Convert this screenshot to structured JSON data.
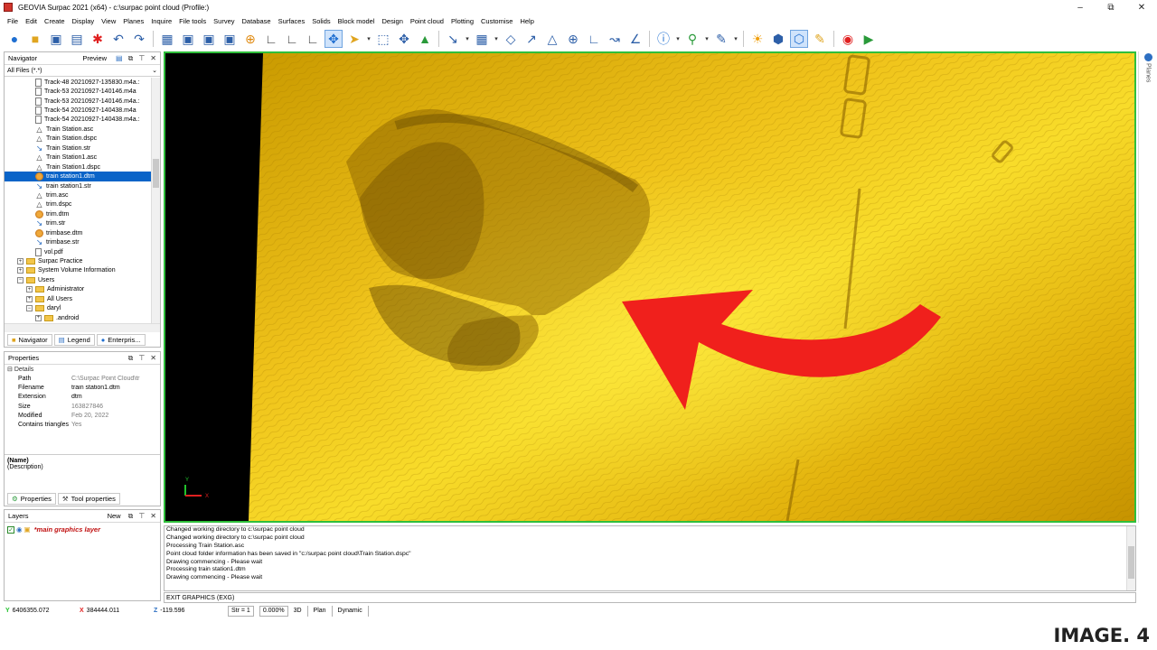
{
  "window": {
    "title": "GEOVIA Surpac 2021 (x64) - c:\\surpac point cloud (Profile:)",
    "minimize": "–",
    "restore": "⧉",
    "close": "✕"
  },
  "menu": [
    "File",
    "Edit",
    "Create",
    "Display",
    "View",
    "Planes",
    "Inquire",
    "File tools",
    "Survey",
    "Database",
    "Surfaces",
    "Solids",
    "Block model",
    "Design",
    "Point cloud",
    "Plotting",
    "Customise",
    "Help"
  ],
  "navigator": {
    "title": "Navigator",
    "preview_label": "Preview",
    "filter": "All Files (*.*)",
    "items": [
      {
        "label": "Track-48 20210927-135830.m4a.:",
        "type": "file",
        "indent": 3
      },
      {
        "label": "Track-53 20210927-140146.m4a",
        "type": "file",
        "indent": 3
      },
      {
        "label": "Track-53 20210927-140146.m4a.:",
        "type": "file",
        "indent": 3
      },
      {
        "label": "Track-54 20210927-140438.m4a",
        "type": "file",
        "indent": 3
      },
      {
        "label": "Track-54 20210927-140438.m4a.:",
        "type": "file",
        "indent": 3
      },
      {
        "label": "Train Station.asc",
        "type": "tri",
        "indent": 3
      },
      {
        "label": "Train Station.dspc",
        "type": "tri",
        "indent": 3
      },
      {
        "label": "Train Station.str",
        "type": "str",
        "indent": 3
      },
      {
        "label": "Train Station1.asc",
        "type": "tri",
        "indent": 3
      },
      {
        "label": "Train Station1.dspc",
        "type": "tri",
        "indent": 3
      },
      {
        "label": "train station1.dtm",
        "type": "dtm",
        "indent": 3,
        "selected": true
      },
      {
        "label": "train station1.str",
        "type": "str",
        "indent": 3
      },
      {
        "label": "trim.asc",
        "type": "tri",
        "indent": 3
      },
      {
        "label": "trim.dspc",
        "type": "tri",
        "indent": 3
      },
      {
        "label": "trim.dtm",
        "type": "dtm",
        "indent": 3
      },
      {
        "label": "trim.str",
        "type": "str",
        "indent": 3
      },
      {
        "label": "trimbase.dtm",
        "type": "dtm",
        "indent": 3
      },
      {
        "label": "trimbase.str",
        "type": "str",
        "indent": 3
      },
      {
        "label": "vol.pdf",
        "type": "file",
        "indent": 3
      },
      {
        "label": "Surpac Practice",
        "type": "folder",
        "indent": 1,
        "expander": "+"
      },
      {
        "label": "System Volume Information",
        "type": "folder",
        "indent": 1,
        "expander": "+"
      },
      {
        "label": "Users",
        "type": "folder",
        "indent": 1,
        "expander": "−"
      },
      {
        "label": "Administrator",
        "type": "folder",
        "indent": 2,
        "expander": "+"
      },
      {
        "label": "All Users",
        "type": "folder",
        "indent": 2,
        "expander": "+"
      },
      {
        "label": "daryl",
        "type": "folder",
        "indent": 2,
        "expander": "−"
      },
      {
        "label": ".android",
        "type": "folder",
        "indent": 3,
        "expander": "+"
      }
    ],
    "tabs": [
      "Navigator",
      "Legend",
      "Enterpris..."
    ]
  },
  "properties": {
    "title": "Properties",
    "section": "Details",
    "rows": [
      {
        "name": "Path",
        "value": "C:\\Surpac Point Cloud\\tr"
      },
      {
        "name": "Filename",
        "value": "train station1.dtm"
      },
      {
        "name": "Extension",
        "value": "dtm"
      },
      {
        "name": "Size",
        "value": "163827846"
      },
      {
        "name": "Modified",
        "value": "Feb 20, 2022"
      },
      {
        "name": "Contains triangles",
        "value": "Yes"
      }
    ],
    "desc_name": "(Name)",
    "desc_text": "(Description)",
    "tabs": [
      "Properties",
      "Tool properties"
    ]
  },
  "layers": {
    "title": "Layers",
    "new_label": "New",
    "items": [
      {
        "name": "*main graphics layer"
      }
    ]
  },
  "viewport": {
    "axis_y": "Y",
    "axis_x": "X"
  },
  "right_strip": {
    "planes_label": "Planes"
  },
  "messages": [
    "Changed working directory to c:\\surpac point cloud",
    "Changed working directory to c:\\surpac point cloud",
    "Processing Train Station.asc",
    "Point cloud folder information has been saved in \"c:/surpac point cloud\\Train Station.dspc\"",
    "Drawing commencing - Please wait",
    "Processing train station1.dtm",
    "Drawing commencing - Please wait"
  ],
  "command": "EXIT GRAPHICS (EXG)",
  "status": {
    "y": "6406355.072",
    "x": "384444.011",
    "z": "-119.596",
    "str": "Str = 1",
    "pct": "0.000%",
    "mode_3d": "3D",
    "mode_plan": "Plan",
    "mode_dynamic": "Dynamic"
  },
  "caption": "IMAGE. 4",
  "colors": {
    "viewport_border": "#2fbf3b",
    "terrain_gold": "#e6b800",
    "arrow_red": "#f0201c",
    "selection_blue": "#0a64c8"
  }
}
